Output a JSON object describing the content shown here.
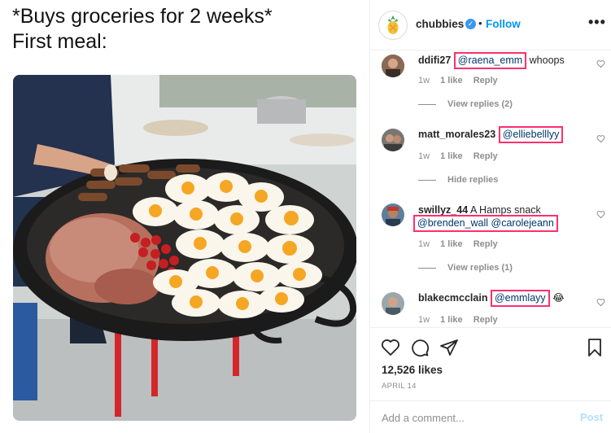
{
  "meme": {
    "caption_line1": "*Buys groceries for 2 weeks*",
    "caption_line2": "First meal:"
  },
  "post": {
    "account": "chubbies",
    "separator": "•",
    "follow_label": "Follow",
    "more_label": "•••",
    "verified_mark": "✓",
    "likes": "12,526 likes",
    "date": "APRIL 14"
  },
  "comments": [
    {
      "user": "ddifi27",
      "mentions": "@raena_emm",
      "text": " whoops",
      "age": "1w",
      "likes": "1 like",
      "reply": "Reply",
      "replies_toggle": "View replies (2)"
    },
    {
      "user": "matt_morales23",
      "mentions": "@elliebelllyy",
      "text": "",
      "age": "1w",
      "likes": "1 like",
      "reply": "Reply",
      "replies_toggle": "Hide replies"
    },
    {
      "user": "swillyz_44",
      "text": " A Hamps snack",
      "mentions": "@brenden_wall @carolejeann",
      "age": "1w",
      "likes": "1 like",
      "reply": "Reply",
      "replies_toggle": "View replies (1)"
    },
    {
      "user": "blakecmcclain",
      "mentions": "@emmlayy",
      "emoji": "😂",
      "age": "1w",
      "likes": "1 like",
      "reply": "Reply"
    }
  ],
  "add_comment": {
    "placeholder": "Add a comment...",
    "post_label": "Post"
  },
  "colors": {
    "accent": "#0095f6",
    "highlight": "#ff2f6d",
    "muted": "#8e8e8e",
    "mention": "#00376b"
  },
  "icons": [
    "pineapple-logo-icon",
    "verified-badge-icon",
    "heart-icon",
    "comment-icon",
    "share-icon",
    "bookmark-icon"
  ]
}
